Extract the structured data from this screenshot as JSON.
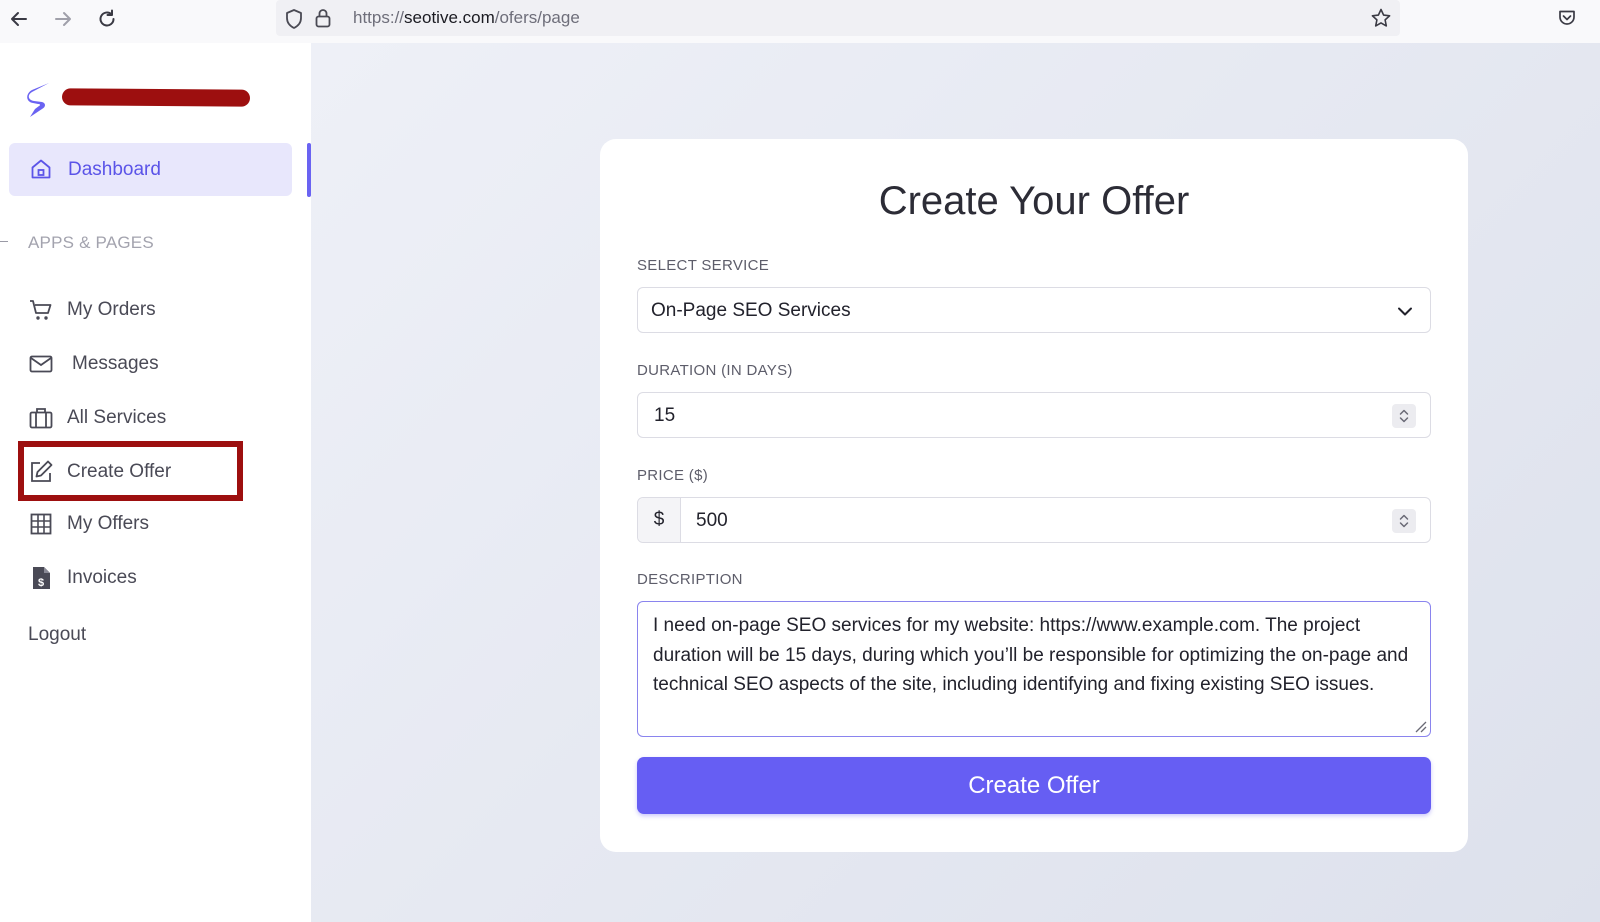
{
  "browser": {
    "url_prefix": "https://",
    "url_domain": "seotive.com",
    "url_path": "/ofers/page"
  },
  "sidebar": {
    "dashboard_label": "Dashboard",
    "section_label": "APPS & PAGES",
    "items": [
      {
        "label": "My Orders",
        "icon": "cart-icon"
      },
      {
        "label": "Messages",
        "icon": "mail-icon"
      },
      {
        "label": "All Services",
        "icon": "briefcase-icon"
      },
      {
        "label": "Create Offer",
        "icon": "edit-icon"
      },
      {
        "label": "My Offers",
        "icon": "grid-icon"
      },
      {
        "label": "Invoices",
        "icon": "invoice-icon"
      }
    ],
    "logout_label": "Logout",
    "accent_color": "#6a63f2",
    "highlight_color": "#9d0f0f"
  },
  "form": {
    "title": "Create Your Offer",
    "service_label": "SELECT SERVICE",
    "service_value": "On-Page SEO Services",
    "duration_label": "DURATION (IN DAYS)",
    "duration_value": "15",
    "price_label": "PRICE ($)",
    "price_prefix": "$",
    "price_value": "500",
    "description_label": "DESCRIPTION",
    "description_value": "I need on-page SEO services for my website: https://www.example.com. The project duration will be 15 days, during which you’ll be responsible for optimizing the on-page and technical SEO aspects of the site, including identifying and fixing existing SEO issues.",
    "submit_label": "Create Offer",
    "button_color": "#665ef3"
  }
}
